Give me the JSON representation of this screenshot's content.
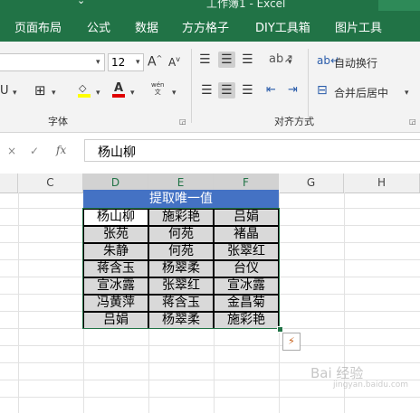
{
  "window": {
    "title_fragment": "工作簿1 - Excel",
    "chevron": "⌄"
  },
  "ribbon_tabs": [
    "页面布局",
    "公式",
    "数据",
    "方方格子",
    "DIY工具箱",
    "图片工具"
  ],
  "ribbon": {
    "font_size": "12",
    "grow_font": "A",
    "shrink_font": "A",
    "wrap_text": "自动换行",
    "merge_center": "合并后居中",
    "font_group": "字体",
    "align_group": "对齐方式",
    "wen_label": "wén\n文"
  },
  "formula_bar": {
    "cancel": "×",
    "enter": "✓",
    "fx": "fx",
    "value": "杨山柳"
  },
  "columns": [
    "C",
    "D",
    "E",
    "F",
    "G",
    "H"
  ],
  "sheet_table": {
    "title": "提取唯一值",
    "rows": [
      [
        "杨山柳",
        "施彩艳",
        "吕娟"
      ],
      [
        "张苑",
        "何苑",
        "褚晶"
      ],
      [
        "朱静",
        "何苑",
        "张翠红"
      ],
      [
        "蒋含玉",
        "杨翠柔",
        "台仪"
      ],
      [
        "宣冰露",
        "张翠红",
        "宣冰露"
      ],
      [
        "冯黄萍",
        "蒋含玉",
        "金昌菊"
      ],
      [
        "吕娟",
        "杨翠柔",
        "施彩艳"
      ]
    ]
  },
  "watermark": "Bai 经验",
  "watermark_url": "jingyan.baidu.com",
  "quick_analysis_icon": "quick-analysis-icon"
}
